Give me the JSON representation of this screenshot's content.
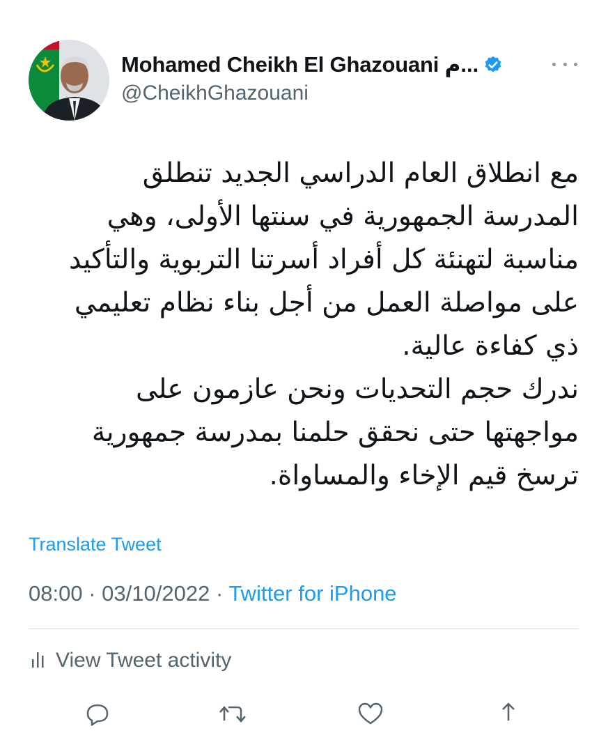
{
  "tweet": {
    "author": {
      "name": "Mohamed Cheikh El Ghazouani م...",
      "handle": "@CheikhGhazouani",
      "verified": true,
      "avatar_icon": "profile-photo-icon"
    },
    "text_lines": [
      "مع انطلاق العام الدراسي الجديد تنطلق",
      "المدرسة الجمهورية في سنتها الأولى، وهي",
      "مناسبة لتهنئة كل أفراد أسرتنا التربوية والتأكيد",
      "على مواصلة العمل من أجل بناء نظام تعليمي",
      "ذي كفاءة عالية.",
      "ندرك حجم التحديات ونحن عازمون على",
      "مواجهتها حتى نحقق حلمنا بمدرسة جمهورية",
      "ترسخ قيم الإخاء والمساواة."
    ],
    "translate_label": "Translate Tweet",
    "time": "08:00",
    "separator": "·",
    "date": "03/10/2022",
    "source": "Twitter for iPhone",
    "activity_label": "View Tweet activity"
  },
  "colors": {
    "link": "#1d9bf0",
    "secondary_text": "#536471",
    "primary_text": "#0f1419",
    "divider": "#cfd9de",
    "verified": "#1d9bf0"
  },
  "icons": {
    "more": "more-icon",
    "verified": "verified-badge-icon",
    "activity": "bar-chart-icon",
    "reply": "reply-icon",
    "retweet": "retweet-icon",
    "like": "heart-icon",
    "share": "share-icon"
  }
}
